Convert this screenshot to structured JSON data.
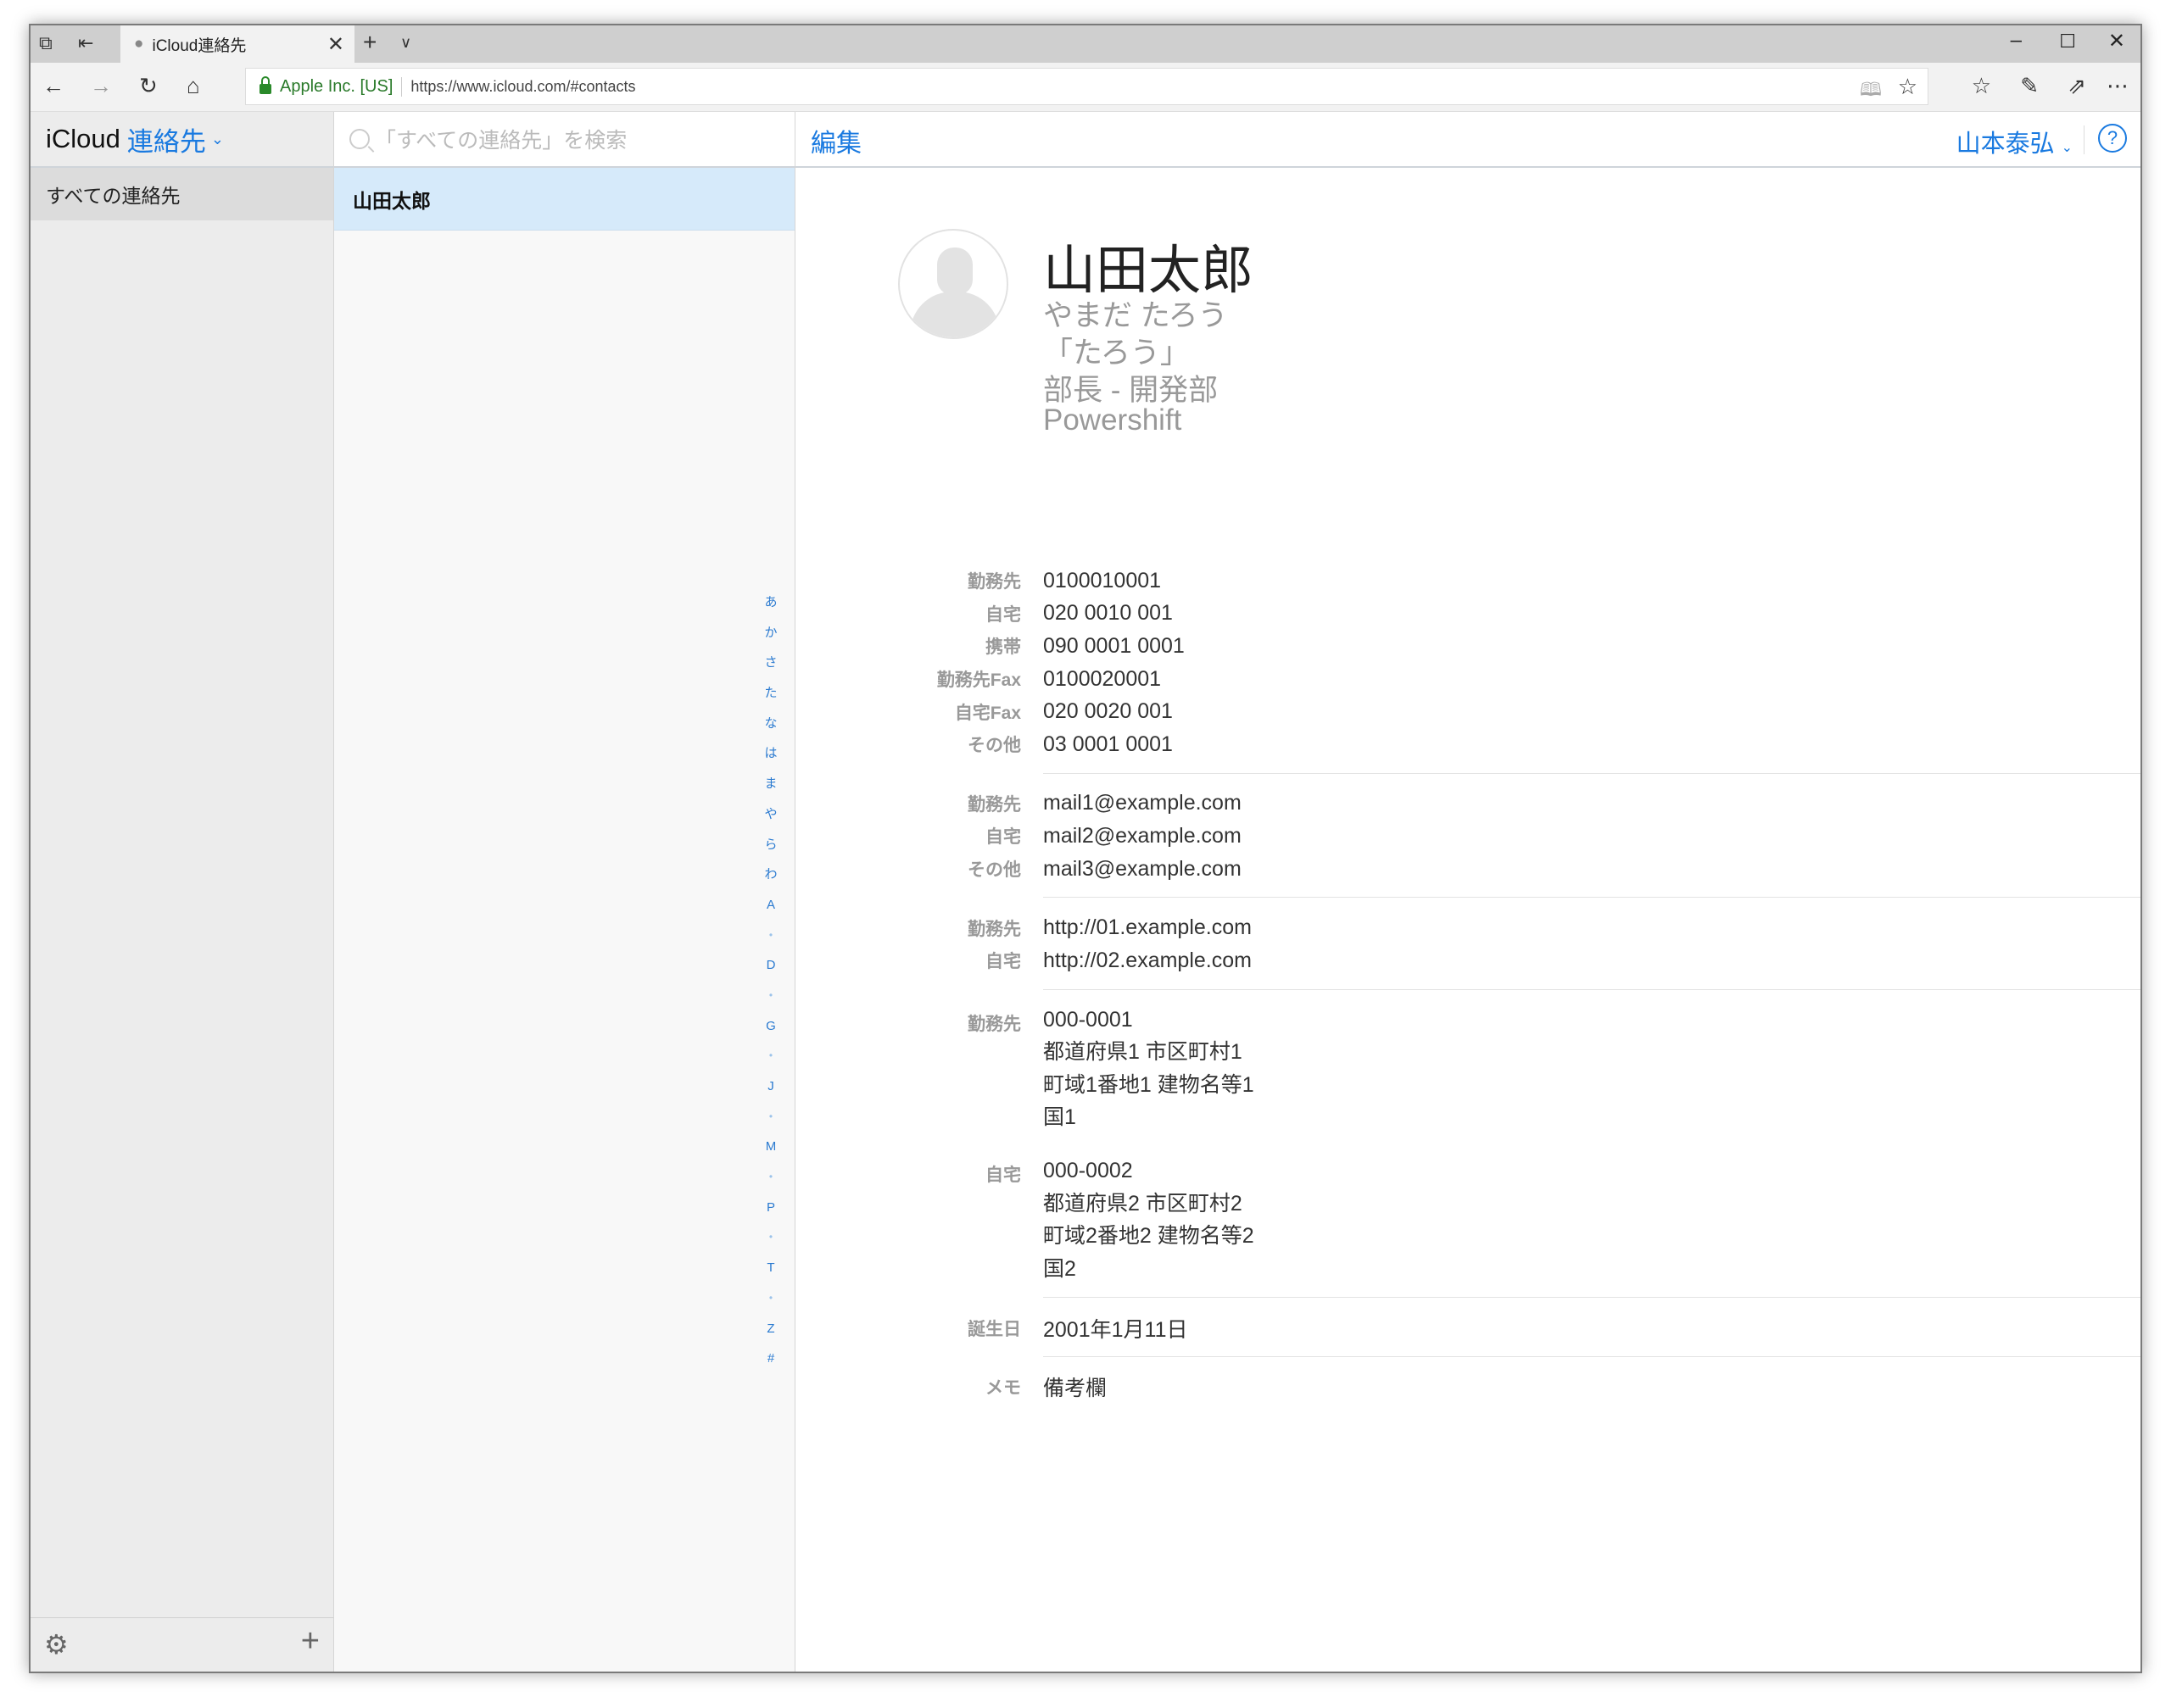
{
  "browser": {
    "tab_title": "iCloud連絡先",
    "cert": "Apple Inc. [US]",
    "url": "https://www.icloud.com/#contacts"
  },
  "sidebar": {
    "brand": "iCloud",
    "app": "連絡先",
    "groups": [
      "すべての連絡先"
    ]
  },
  "list": {
    "search_placeholder": "「すべての連絡先」を検索",
    "contacts": [
      "山田太郎"
    ],
    "index": [
      "あ",
      "か",
      "さ",
      "た",
      "な",
      "は",
      "ま",
      "や",
      "ら",
      "わ",
      "A",
      "•",
      "D",
      "•",
      "G",
      "•",
      "J",
      "•",
      "M",
      "•",
      "P",
      "•",
      "T",
      "•",
      "Z",
      "#"
    ]
  },
  "header": {
    "edit": "編集",
    "user": "山本泰弘",
    "help": "?"
  },
  "contact": {
    "name": "山田太郎",
    "phonetic": "やまだ たろう",
    "nickname": "「たろう」",
    "title": "部長 - 開発部",
    "company": "Powershift",
    "phones": [
      {
        "label": "勤務先",
        "value": "0100010001"
      },
      {
        "label": "自宅",
        "value": "020 0010 001"
      },
      {
        "label": "携帯",
        "value": "090 0001 0001"
      },
      {
        "label": "勤務先Fax",
        "value": "0100020001"
      },
      {
        "label": "自宅Fax",
        "value": "020 0020 001"
      },
      {
        "label": "その他",
        "value": "03 0001 0001"
      }
    ],
    "emails": [
      {
        "label": "勤務先",
        "value": "mail1@example.com"
      },
      {
        "label": "自宅",
        "value": "mail2@example.com"
      },
      {
        "label": "その他",
        "value": "mail3@example.com"
      }
    ],
    "urls": [
      {
        "label": "勤務先",
        "value": "http://01.example.com"
      },
      {
        "label": "自宅",
        "value": "http://02.example.com"
      }
    ],
    "addresses": [
      {
        "label": "勤務先",
        "lines": [
          "000-0001",
          "都道府県1 市区町村1",
          "町域1番地1 建物名等1",
          "国1"
        ]
      },
      {
        "label": "自宅",
        "lines": [
          "000-0002",
          "都道府県2 市区町村2",
          "町域2番地2 建物名等2",
          "国2"
        ]
      }
    ],
    "birthday": {
      "label": "誕生日",
      "value": "2001年1月11日"
    },
    "memo": {
      "label": "メモ",
      "value": "備考欄"
    }
  }
}
